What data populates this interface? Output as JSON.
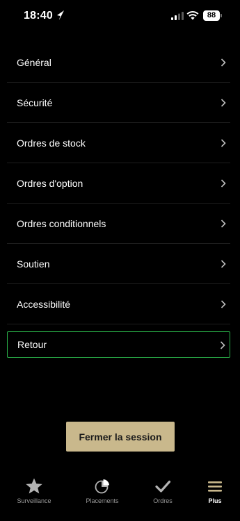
{
  "status_bar": {
    "time": "18:40",
    "battery": "88"
  },
  "menu": {
    "items": [
      {
        "label": "Général"
      },
      {
        "label": "Sécurité"
      },
      {
        "label": "Ordres de stock"
      },
      {
        "label": "Ordres d'option"
      },
      {
        "label": "Ordres conditionnels"
      },
      {
        "label": "Soutien"
      },
      {
        "label": "Accessibilité"
      },
      {
        "label": "Retour"
      }
    ]
  },
  "logout_label": "Fermer la session",
  "tabs": [
    {
      "label": "Surveillance",
      "icon": "star-icon"
    },
    {
      "label": "Placements",
      "icon": "pie-chart-icon"
    },
    {
      "label": "Ordres",
      "icon": "checkmark-icon"
    },
    {
      "label": "Plus",
      "icon": "menu-icon"
    }
  ],
  "colors": {
    "accent_border": "#2bb34a",
    "logout_button": "#c9b88c",
    "background": "#000000"
  }
}
